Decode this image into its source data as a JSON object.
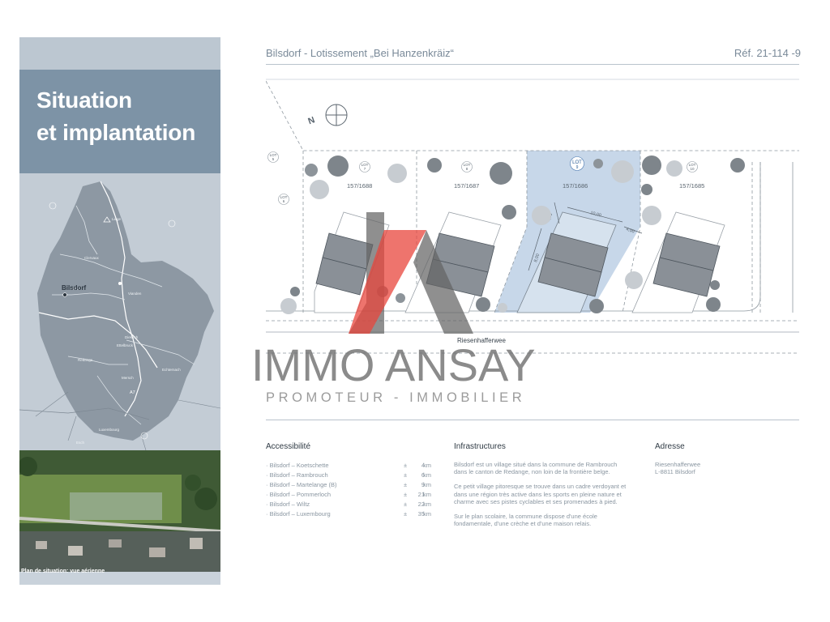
{
  "sidebar": {
    "title_line1": "Situation",
    "title_line2": "et implantation",
    "map_labels": [
      "Liège",
      "Clervaux",
      "Wiltz",
      "Bilsdorf",
      "Diekirch",
      "Ettelbruck",
      "Mersch",
      "Redange",
      "Vianden",
      "Echternach",
      "Luxembourg",
      "Esch",
      "A7"
    ],
    "map_city": "Bilsdorf",
    "aerial_caption": "Plan de situation: vue aérienne"
  },
  "header": {
    "title": "Bilsdorf - Lotissement „Bei Hanzenkräiz“",
    "reference": "Réf. 21-114 -9"
  },
  "plan": {
    "north_label": "N",
    "lot_labels": [
      {
        "lot": "LOT",
        "num": "5"
      },
      {
        "lot": "LOT",
        "num": "6"
      },
      {
        "lot": "LOT",
        "num": "7"
      },
      {
        "lot": "LOT",
        "num": "8"
      },
      {
        "lot": "LOT",
        "num": "9"
      },
      {
        "lot": "LOT",
        "num": "10"
      }
    ],
    "parcels": [
      "157/1688",
      "157/1687",
      "157/1686",
      "157/1685"
    ],
    "dimensions": [
      "4,00",
      "10,00",
      "4,00",
      "8,00"
    ],
    "street_name": "Riesenhafferwee",
    "highlight_color": "#b9cde3"
  },
  "watermark": {
    "name": "IMMO ANSAY",
    "subtitle": "PROMOTEUR - IMMOBILIER",
    "accent_color": "#e8453c"
  },
  "accessibility": {
    "title": "Accessibilité",
    "items": [
      {
        "name": "· Bilsdorf – Koetschette",
        "pm": "±",
        "value": "4",
        "unit": "km"
      },
      {
        "name": "· Bilsdorf – Rambrouch",
        "pm": "±",
        "value": "6",
        "unit": "km"
      },
      {
        "name": "· Bilsdorf – Martelange (B)",
        "pm": "±",
        "value": "9",
        "unit": "km"
      },
      {
        "name": "· Bilsdorf – Pommerloch",
        "pm": "±",
        "value": "21",
        "unit": "km"
      },
      {
        "name": "· Bilsdorf – Wiltz",
        "pm": "±",
        "value": "22",
        "unit": "km"
      },
      {
        "name": "· Bilsdorf – Luxembourg",
        "pm": "±",
        "value": "35",
        "unit": "km"
      }
    ]
  },
  "infrastructures": {
    "title": "Infrastructures",
    "paragraphs": [
      "Bilsdorf est un village situé dans la commune de Rambrouch dans le canton de Redange, non loin de la frontière belge.",
      "Ce petit village pitoresque se trouve dans un cadre verdoyant et dans une région très active dans les sports en pleine nature et charme avec ses pistes cyclables et ses promenades à pied.",
      "Sur le plan scolaire, la commune dispose d'une école fondamentale, d'une crèche et d'une maison relais."
    ]
  },
  "address": {
    "title": "Adresse",
    "line1": "Riesenhafferwee",
    "line2": "L-8811 Bilsdorf"
  }
}
